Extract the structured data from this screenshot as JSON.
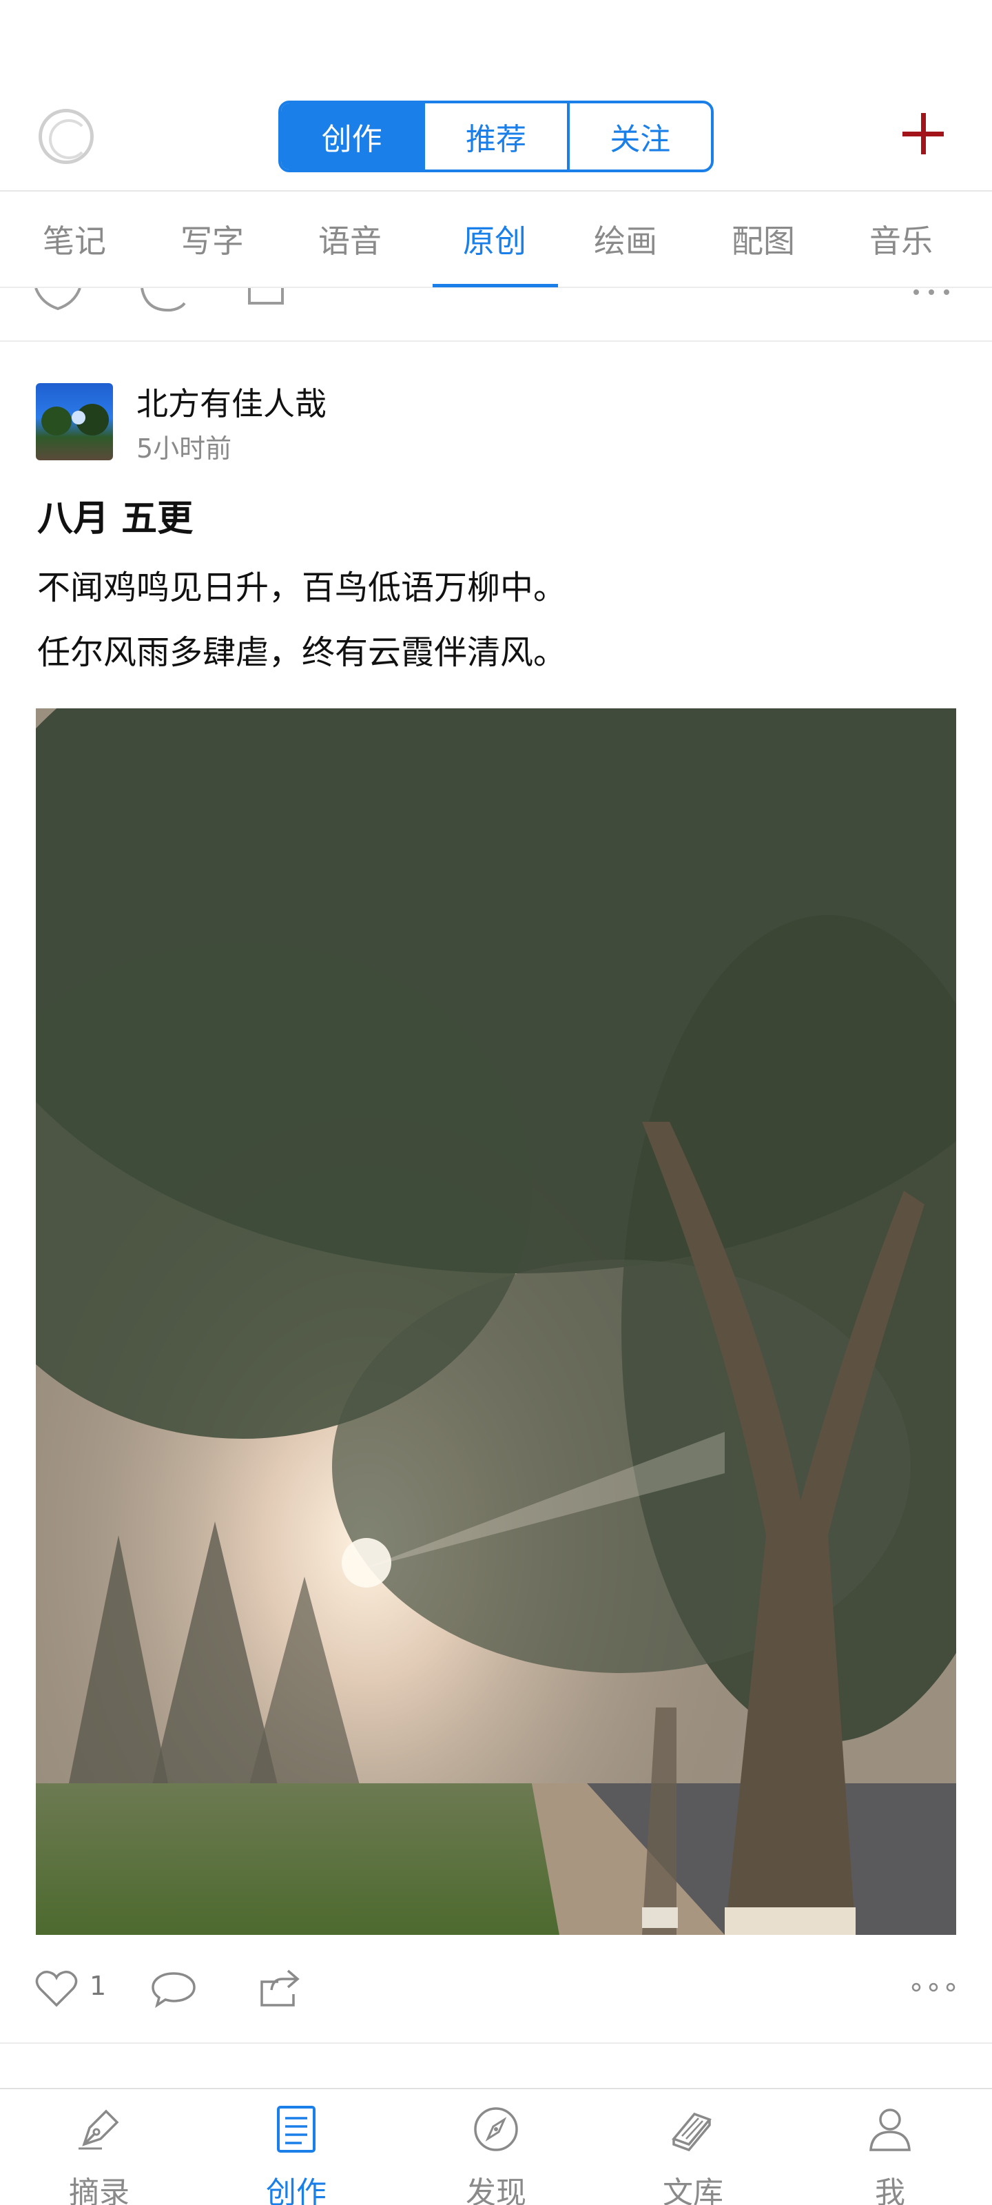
{
  "header": {
    "segments": [
      "创作",
      "推荐",
      "关注"
    ],
    "active_segment": "创作"
  },
  "categories": [
    "笔记",
    "写字",
    "语音",
    "原创",
    "绘画",
    "配图",
    "音乐"
  ],
  "active_category": "原创",
  "post": {
    "author": "北方有佳人哉",
    "time": "5小时前",
    "title": "八月  五更",
    "lines": [
      "不闻鸡鸣见日升，百鸟低语万柳中。",
      "任尔风雨多肆虐，终有云霞伴清风。"
    ],
    "like_count": "1"
  },
  "bottom_nav": [
    {
      "label": "摘录",
      "icon": "pen-nib-icon"
    },
    {
      "label": "创作",
      "icon": "document-icon"
    },
    {
      "label": "发现",
      "icon": "compass-icon"
    },
    {
      "label": "文库",
      "icon": "books-icon"
    },
    {
      "label": "我",
      "icon": "person-icon"
    }
  ],
  "colors": {
    "accent": "#1a7fe8",
    "plus": "#a3131a",
    "muted": "#8a8a8a"
  }
}
